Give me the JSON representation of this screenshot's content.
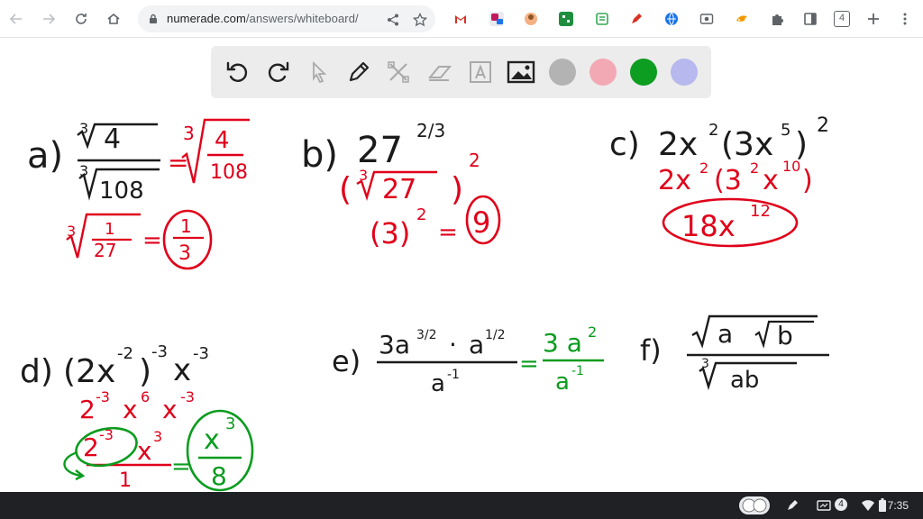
{
  "browser": {
    "url_host": "numerade.com",
    "url_path": "/answers/whiteboard/",
    "tab_count": "4"
  },
  "colors": {
    "black": "#1b1b1b",
    "red": "#e0001a",
    "green": "#0a9c1e",
    "palette": [
      "#b3b3b3",
      "#f2a9b4",
      "#0c9d21",
      "#b7b8ee"
    ]
  },
  "board": {
    "a": {
      "label": "a)",
      "num_index": "3",
      "num_radicand": "4",
      "den_index": "3",
      "den_radicand": "108",
      "eq": "=",
      "step_index": "3",
      "step_num": "4",
      "step_den": "108",
      "step2_index": "3",
      "step2_num": "1",
      "step2_den": "27",
      "eq2": "=",
      "ans_num": "1",
      "ans_den": "3"
    },
    "b": {
      "label": "b)",
      "base": "27",
      "exp": "2/3",
      "root_index": "3",
      "root_radicand": "27",
      "root_exp": "2",
      "step_base": "(3)",
      "step_exp": "2",
      "eq": "=",
      "answer": "9"
    },
    "c": {
      "label": "c)",
      "expr_coef": "2x",
      "expr_exp1": "2",
      "expr_paren": "(3x",
      "expr_exp2": "5",
      "expr_close": ")",
      "expr_exp3": "2",
      "step_coef": "2x",
      "step_exp1": "2",
      "step_paren": "(3",
      "step_exp2": "2",
      "step_x": "x",
      "step_exp3": "10",
      "step_close": ")",
      "answer": "18x",
      "answer_exp": "12"
    },
    "d": {
      "label": "d)",
      "expr": "(2x",
      "exp1": "-2",
      "close": ")",
      "exp2": "-3",
      "x": "x",
      "exp3": "-3",
      "step_a": "2",
      "step_a_exp": "-3",
      "step_b": "x",
      "step_b_exp": "6",
      "step_c": "x",
      "step_c_exp": "-3",
      "num_two": "2",
      "num_two_exp": "-3",
      "num_x": "x",
      "num_x_exp": "3",
      "den": "1",
      "eq": "=",
      "ans_num": "x",
      "ans_num_exp": "3",
      "ans_den": "8"
    },
    "e": {
      "label": "e)",
      "num": "3a",
      "num_exp": "3/2",
      "dot": "·",
      "a": "a",
      "a_exp": "1/2",
      "den": "a",
      "den_exp": "-1",
      "eq": "=",
      "ans_num": "3 a",
      "ans_num_exp": "2",
      "ans_den": "a",
      "ans_den_exp": "-1"
    },
    "f": {
      "label": "f)",
      "num_a": "a",
      "num_b": "b",
      "den_index": "3",
      "den_radicand": "ab"
    }
  },
  "shelf": {
    "notif_count": "4",
    "time": "7:35"
  }
}
